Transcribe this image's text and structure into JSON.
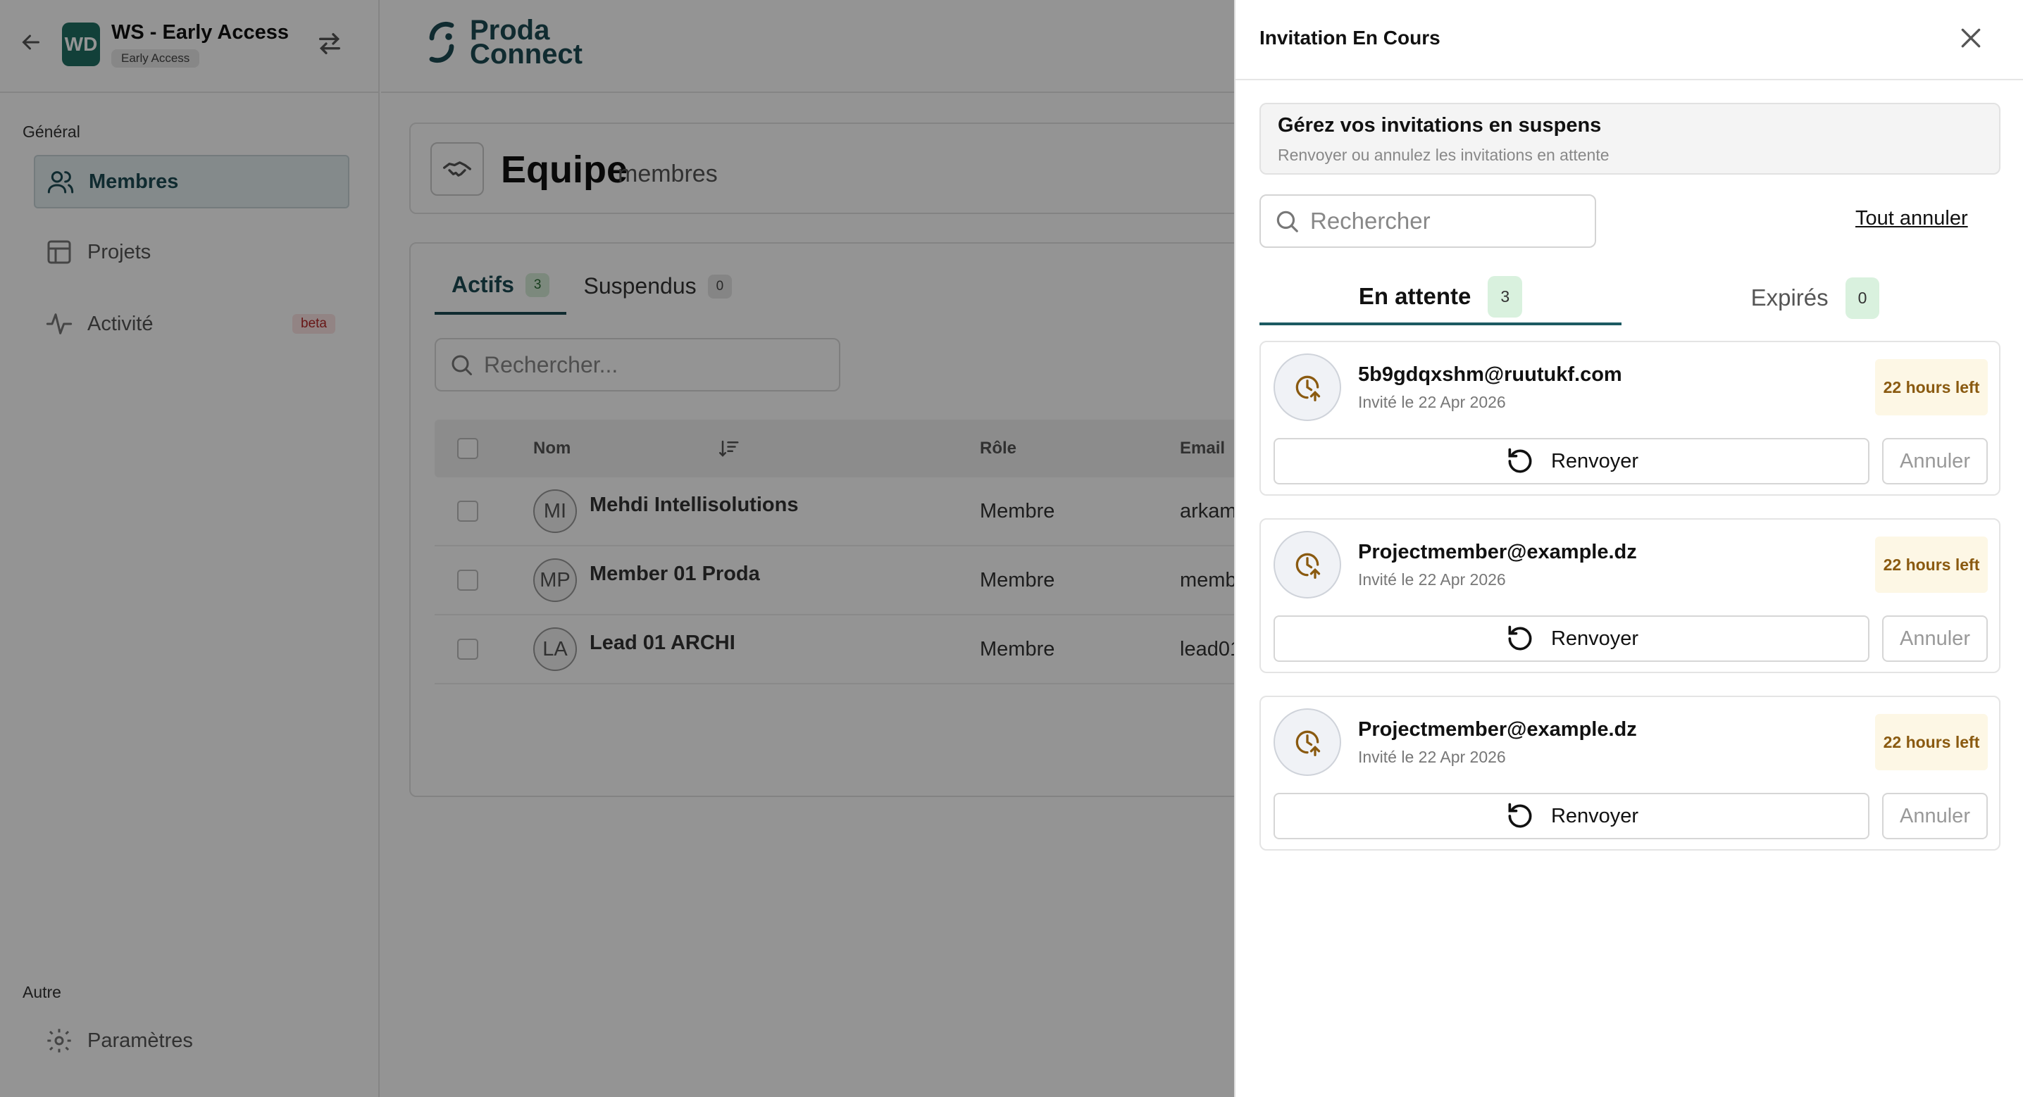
{
  "workspace": {
    "avatar_initials": "WD",
    "title": "WS - Early Access ...",
    "badge": "Early Access"
  },
  "sidebar": {
    "section_general": "Général",
    "items": [
      {
        "label": "Membres",
        "icon": "users-icon",
        "active": true
      },
      {
        "label": "Projets",
        "icon": "layout-icon"
      },
      {
        "label": "Activité",
        "icon": "activity-icon",
        "badge": "beta"
      }
    ],
    "section_other": "Autre",
    "settings_label": "Paramètres"
  },
  "logo": {
    "line1": "Proda",
    "line2": "Connect"
  },
  "team": {
    "title": "Equipe",
    "subtitle": "membres"
  },
  "member_tabs": [
    {
      "label": "Actifs",
      "count": "3",
      "active": true
    },
    {
      "label": "Suspendus",
      "count": "0"
    }
  ],
  "member_search": {
    "placeholder": "Rechercher..."
  },
  "table": {
    "headers": {
      "name": "Nom",
      "role": "Rôle",
      "email": "Email"
    },
    "rows": [
      {
        "initials": "MI",
        "name": "Mehdi Intellisolutions",
        "role": "Membre",
        "email": "arkam"
      },
      {
        "initials": "MP",
        "name": "Member 01 Proda",
        "role": "Membre",
        "email": "memb"
      },
      {
        "initials": "LA",
        "name": "Lead 01 ARCHI",
        "role": "Membre",
        "email": "lead01"
      }
    ]
  },
  "drawer": {
    "title": "Invitation En Cours",
    "info_title": "Gérez vos invitations en suspens",
    "info_sub": "Renvoyer ou annulez les invitations en attente",
    "search_placeholder": "Rechercher",
    "cancel_all": "Tout annuler",
    "tabs": [
      {
        "label": "En attente",
        "count": "3",
        "active": true
      },
      {
        "label": "Expirés",
        "count": "0"
      }
    ],
    "invitations": [
      {
        "email": "5b9gdqxshm@ruutukf.com",
        "date": "Invité le 22 Apr 2026",
        "time_left": "22 hours left",
        "resend": "Renvoyer",
        "cancel": "Annuler"
      },
      {
        "email": "Projectmember@example.dz",
        "date": "Invité le 22 Apr 2026",
        "time_left": "22 hours left",
        "resend": "Renvoyer",
        "cancel": "Annuler"
      },
      {
        "email": "Projectmember@example.dz",
        "date": "Invité le 22 Apr 2026",
        "time_left": "22 hours left",
        "resend": "Renvoyer",
        "cancel": "Annuler"
      }
    ]
  },
  "colors": {
    "brand": "#1c4a54",
    "accent_green": "#1f6e63",
    "badge_green": "#d9f1de",
    "time_badge": "#fdf7e5"
  }
}
